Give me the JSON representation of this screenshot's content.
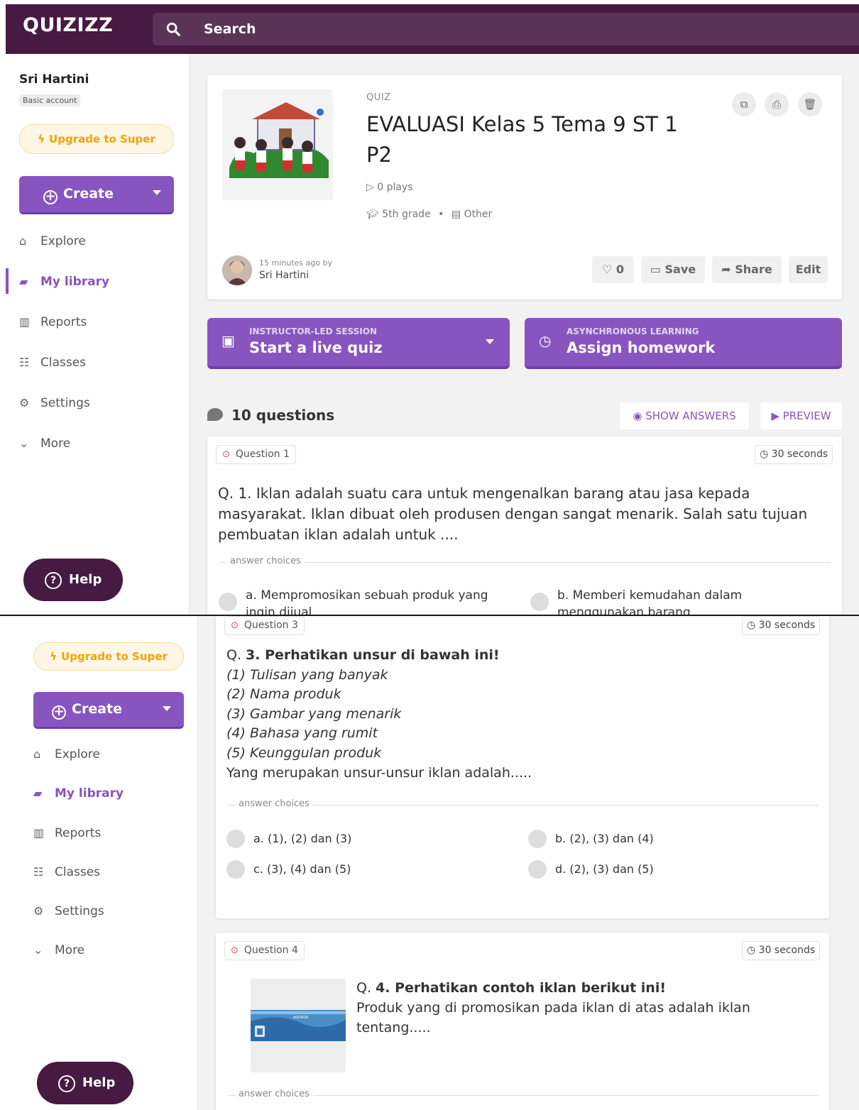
{
  "app": {
    "logo": "QUIZIZZ",
    "search_label": "Search"
  },
  "user": {
    "name": "Sri Hartini",
    "badge": "Basic account"
  },
  "sidebar": {
    "upgrade_label": "Upgrade to Super",
    "create_label": "Create",
    "items": [
      {
        "label": "Explore",
        "icon": "explore-icon"
      },
      {
        "label": "My library",
        "icon": "folder-icon",
        "active": true
      },
      {
        "label": "Reports",
        "icon": "reports-icon"
      },
      {
        "label": "Classes",
        "icon": "classes-icon"
      },
      {
        "label": "Settings",
        "icon": "gear-icon"
      },
      {
        "label": "More",
        "icon": "chevron-down-icon"
      }
    ],
    "help_label": "Help"
  },
  "quiz": {
    "type_label": "QUIZ",
    "title": "EVALUASI Kelas 5 Tema 9 ST 1 P2",
    "plays": "0 plays",
    "grade": "5th grade",
    "subject": "Other",
    "author_time": "15 minutes ago by",
    "author_name": "Sri Hartini",
    "likes": "0",
    "save_label": "Save",
    "share_label": "Share",
    "edit_label": "Edit"
  },
  "launch": {
    "live_sub": "INSTRUCTOR-LED SESSION",
    "live_main": "Start a live quiz",
    "hw_sub": "ASYNCHRONOUS LEARNING",
    "hw_main": "Assign homework"
  },
  "questions_header": {
    "count_label": "10 questions",
    "show_answers_label": "SHOW ANSWERS",
    "preview_label": "PREVIEW"
  },
  "answer_choices_label": "answer choices",
  "questions": [
    {
      "label": "Question 1",
      "time": "30 seconds",
      "text": "Q. 1. Iklan adalah suatu cara untuk mengenalkan barang atau jasa kepada masyarakat. Iklan dibuat oleh produsen dengan sangat menarik. Salah satu tujuan pembuatan iklan adalah untuk ....",
      "choices": [
        "a. Mempromosikan sebuah produk yang ingin dijual",
        "b. Memberi kemudahan dalam menggunakan barang"
      ]
    },
    {
      "label": "Question 3",
      "time": "30 seconds",
      "prefix": "Q. ",
      "heading": "3. Perhatikan unsur di bawah ini!",
      "lines": [
        "(1) Tulisan yang banyak",
        "(2) Nama produk",
        "(3) Gambar yang menarik",
        "(4) Bahasa yang rumit",
        "(5) Keunggulan produk"
      ],
      "footer": "Yang merupakan unsur-unsur iklan adalah.....",
      "choices": [
        "a. (1), (2) dan (3)",
        "b. (2), (3) dan (4)",
        "c. (3), (4) dan (5)",
        "d. (2), (3) dan (5)"
      ]
    },
    {
      "label": "Question 4",
      "time": "30 seconds",
      "prefix": "Q. ",
      "heading": "4. Perhatikan contoh iklan berikut ini!",
      "body": "Produk yang di promosikan pada iklan di atas adalah iklan tentang.....",
      "image_caption": "AQUADA"
    }
  ],
  "colors": {
    "brand_dark": "#461a42",
    "brand_purple": "#8854c0",
    "upgrade_orange": "#f0a500"
  }
}
